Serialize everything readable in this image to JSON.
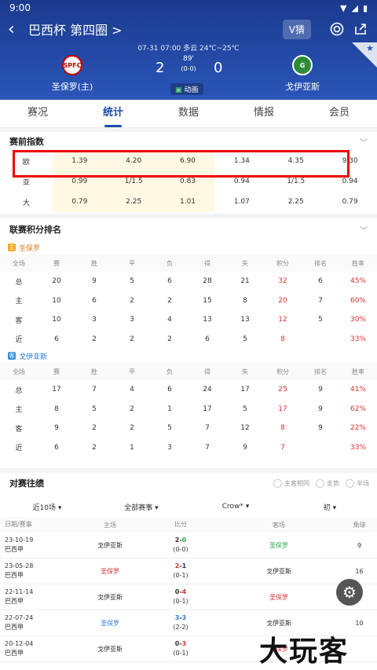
{
  "status": {
    "time": "9:00"
  },
  "header": {
    "title": "巴西杯 第四圈 >",
    "vguess": "V猜",
    "meta": "07-31 07:00  多云 24℃~25℃",
    "home": {
      "logo": "SPFC",
      "name": "圣保罗(主)",
      "score": "2"
    },
    "away": {
      "logo": "G",
      "name": "戈伊亚斯",
      "score": "0"
    },
    "minute": "89'",
    "halftime": "(0-0)",
    "anim_label": "动画"
  },
  "tabs": [
    "赛况",
    "统计",
    "数据",
    "情报",
    "会员"
  ],
  "odds": {
    "title": "赛前指数",
    "rows": [
      {
        "label": "欧",
        "cells": [
          "1.39",
          "4.20",
          "6.90",
          "1.34",
          "4.35",
          "9.30"
        ]
      },
      {
        "label": "亚",
        "cells": [
          "0.99",
          "1/1.5",
          "0.83",
          "0.94",
          "1/1.5",
          "0.94"
        ]
      },
      {
        "label": "大",
        "cells": [
          "0.79",
          "2.25",
          "1.01",
          "1.07",
          "2.25",
          "0.79"
        ]
      }
    ]
  },
  "standings": {
    "title": "联赛积分排名",
    "headers": [
      "全场",
      "赛",
      "胜",
      "平",
      "负",
      "得",
      "失",
      "积分",
      "排名",
      "胜率"
    ],
    "home": {
      "name": "圣保罗",
      "badge": "主",
      "rows": [
        [
          "总",
          "20",
          "9",
          "5",
          "6",
          "28",
          "21",
          "32",
          "6",
          "45%"
        ],
        [
          "主",
          "10",
          "6",
          "2",
          "2",
          "15",
          "8",
          "20",
          "7",
          "60%"
        ],
        [
          "客",
          "10",
          "3",
          "3",
          "4",
          "13",
          "13",
          "12",
          "5",
          "30%"
        ],
        [
          "近",
          "6",
          "2",
          "2",
          "2",
          "6",
          "5",
          "8",
          "",
          "33%"
        ]
      ]
    },
    "away": {
      "name": "戈伊亚斯",
      "badge": "客",
      "rows": [
        [
          "总",
          "17",
          "7",
          "4",
          "6",
          "24",
          "17",
          "25",
          "9",
          "41%"
        ],
        [
          "主",
          "8",
          "5",
          "2",
          "1",
          "17",
          "5",
          "17",
          "9",
          "62%"
        ],
        [
          "客",
          "9",
          "2",
          "2",
          "5",
          "7",
          "12",
          "8",
          "9",
          "22%"
        ],
        [
          "近",
          "6",
          "2",
          "1",
          "3",
          "7",
          "9",
          "7",
          "",
          "33%"
        ]
      ]
    }
  },
  "h2h": {
    "title": "对赛往绩",
    "filters": [
      "主客相同",
      "走势",
      "半场"
    ],
    "selectors": [
      "近10场 ▾",
      "全部赛事 ▾",
      "Crow* ▾",
      "初 ▾"
    ],
    "headers": [
      "日期/赛事",
      "主场",
      "比分",
      "客场",
      "角球"
    ],
    "rows": [
      {
        "date": "23-10-19",
        "league": "巴西甲",
        "home": "戈伊亚斯",
        "score": "2-0",
        "ht": "(0-0)",
        "away": "圣保罗",
        "corner": "9",
        "home_cls": "",
        "away_cls": "green-txt"
      },
      {
        "date": "23-05-28",
        "league": "巴西甲",
        "home": "圣保罗",
        "score": "2-1",
        "ht": "(0-1)",
        "away": "戈伊亚斯",
        "corner": "16",
        "home_cls": "red-txt",
        "away_cls": ""
      },
      {
        "date": "22-11-14",
        "league": "巴西甲",
        "home": "戈伊亚斯",
        "score": "0-4",
        "ht": "(0-1)",
        "away": "圣保罗",
        "corner": "7",
        "home_cls": "",
        "away_cls": "red-txt"
      },
      {
        "date": "22-07-24",
        "league": "巴西甲",
        "home": "圣保罗",
        "score": "3-3",
        "ht": "(2-2)",
        "away": "戈伊亚斯",
        "corner": "10",
        "home_cls": "blue-txt",
        "away_cls": ""
      },
      {
        "date": "20-12-04",
        "league": "巴西甲",
        "home": "戈伊亚斯",
        "score": "0-3",
        "ht": "(0-1)",
        "away": "圣保罗",
        "corner": "",
        "home_cls": "",
        "away_cls": "red-txt"
      }
    ]
  },
  "watermark": "大玩客"
}
